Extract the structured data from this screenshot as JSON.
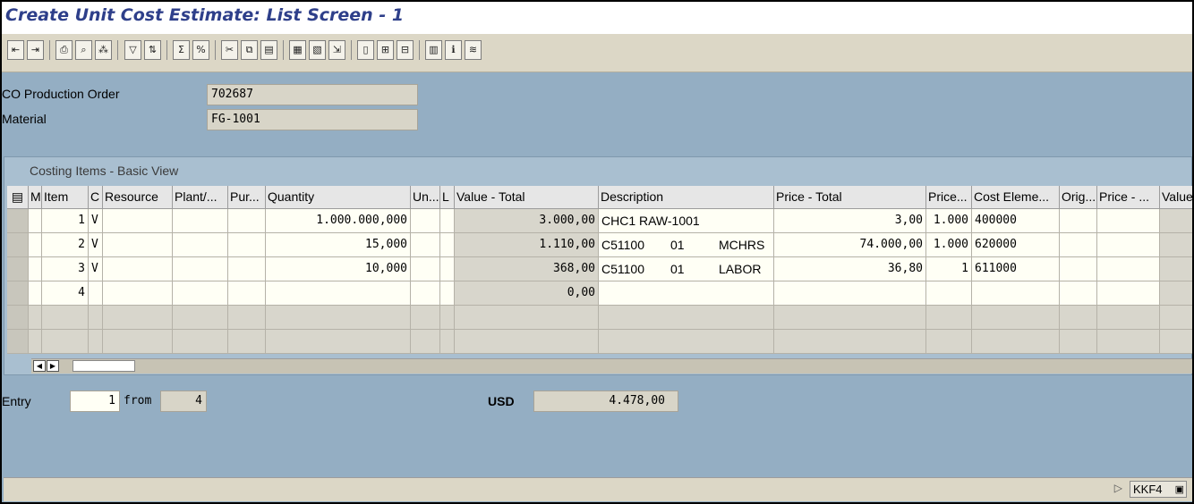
{
  "window": {
    "title": "Create Unit Cost Estimate: List Screen - 1"
  },
  "header": {
    "production_order_label": "CO Production Order",
    "production_order_value": "702687",
    "material_label": "Material",
    "material_value": "FG-1001"
  },
  "table": {
    "title": "Costing Items - Basic View",
    "columns": [
      "M",
      "Item",
      "C",
      "Resource",
      "Plant/...",
      "Pur...",
      "Quantity",
      "Un...",
      "L",
      "Value - Total",
      "Description",
      "Price - Total",
      "Price...",
      "Cost Eleme...",
      "Orig...",
      "Price - ...",
      "Value"
    ],
    "rows": [
      {
        "item": "1",
        "cat": "V",
        "quantity": "1.000.000,000",
        "value_total": "3.000,00",
        "description": "CHC1 RAW-1001",
        "desc2": "",
        "desc3": "",
        "price_total": "3,00",
        "price_unit": "1.000",
        "cost_element": "400000"
      },
      {
        "item": "2",
        "cat": "V",
        "quantity": "15,000",
        "value_total": "1.110,00",
        "description": "C51100",
        "desc2": "01",
        "desc3": "MCHRS",
        "price_total": "74.000,00",
        "price_unit": "1.000",
        "cost_element": "620000"
      },
      {
        "item": "3",
        "cat": "V",
        "quantity": "10,000",
        "value_total": "368,00",
        "description": "C51100",
        "desc2": "01",
        "desc3": "LABOR",
        "price_total": "36,80",
        "price_unit": "1",
        "cost_element": "611000"
      },
      {
        "item": "4",
        "cat": "",
        "quantity": "",
        "value_total": "0,00",
        "description": "",
        "desc2": "",
        "desc3": "",
        "price_total": "",
        "price_unit": "",
        "cost_element": ""
      },
      {
        "item": "",
        "cat": "",
        "quantity": "",
        "value_total": "",
        "description": "",
        "desc2": "",
        "desc3": "",
        "price_total": "",
        "price_unit": "",
        "cost_element": ""
      },
      {
        "item": "",
        "cat": "",
        "quantity": "",
        "value_total": "",
        "description": "",
        "desc2": "",
        "desc3": "",
        "price_total": "",
        "price_unit": "",
        "cost_element": ""
      }
    ]
  },
  "footer": {
    "entry_label": "Entry",
    "entry_value": "1",
    "from_label": "from",
    "from_value": "4",
    "currency": "USD",
    "total": "4.478,00"
  },
  "status": {
    "tcode": "KKF4"
  },
  "icons": [
    "save-first-icon",
    "save-last-icon",
    "print-icon",
    "find-icon",
    "find-next-icon",
    "filter-icon",
    "sort-icon",
    "sum-icon",
    "percent-icon",
    "cut-icon",
    "copy-icon",
    "paste-icon",
    "insert-row-icon",
    "delete-row-icon",
    "select-icon",
    "trash-icon",
    "append-icon",
    "append-below-icon",
    "detail-icon",
    "info-icon",
    "layout-icon"
  ]
}
